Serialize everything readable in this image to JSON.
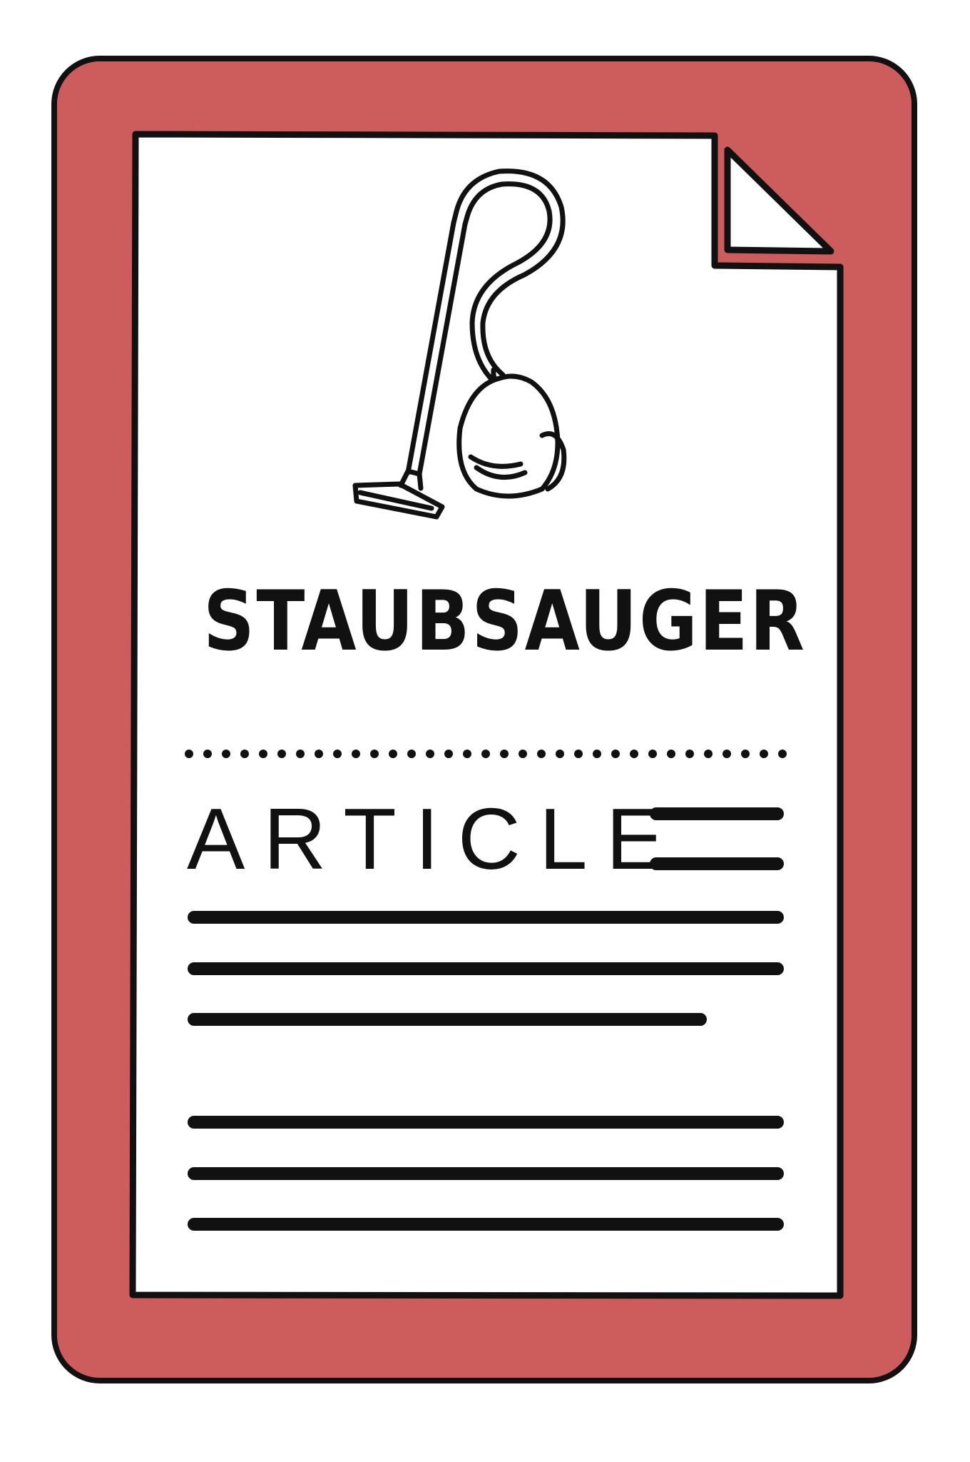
{
  "colors": {
    "frame": "#cd5c5c",
    "paper": "#ffffff",
    "ink": "#111111"
  },
  "icons": {
    "main": "vacuum-cleaner-icon",
    "document": "folded-corner-page"
  },
  "card": {
    "title": "STAUBSAUGER",
    "label": "ARTICLE"
  }
}
